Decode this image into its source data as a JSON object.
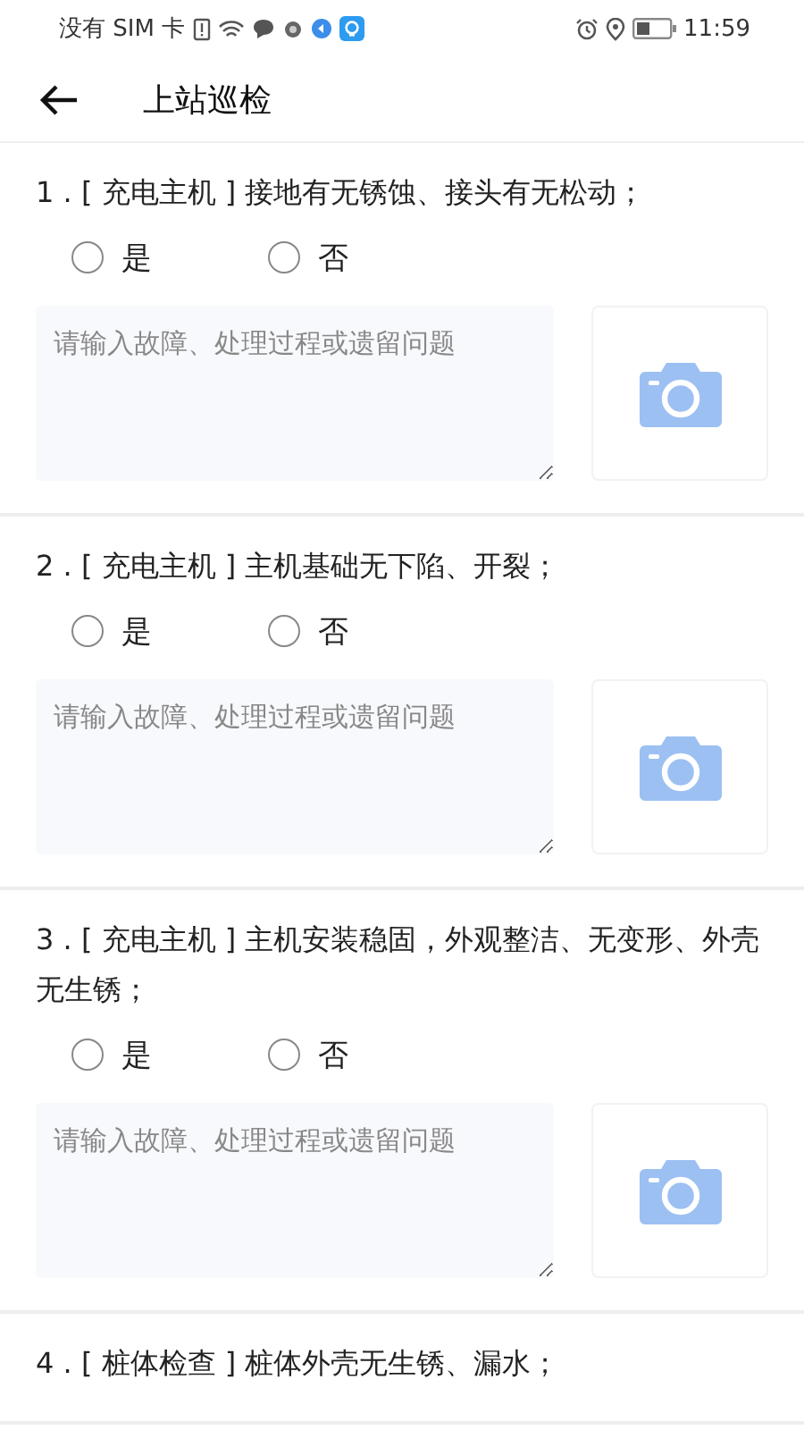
{
  "status_bar": {
    "carrier": "没有 SIM 卡",
    "time": "11:59"
  },
  "header": {
    "title": "上站巡检"
  },
  "items": [
    {
      "question": "1 . [ 充电主机 ] 接地有无锈蚀、接头有无松动；",
      "options": [
        {
          "label": "是",
          "selected": false
        },
        {
          "label": "否",
          "selected": false
        }
      ],
      "note": {
        "placeholder": "请输入故障、处理过程或遗留问题"
      }
    },
    {
      "question": "2 . [ 充电主机 ] 主机基础无下陷、开裂；",
      "options": [
        {
          "label": "是",
          "selected": false
        },
        {
          "label": "否",
          "selected": false
        }
      ],
      "note": {
        "placeholder": "请输入故障、处理过程或遗留问题"
      }
    },
    {
      "question": "3 . [ 充电主机 ] 主机安装稳固，外观整洁、无变形、外壳无生锈；",
      "options": [
        {
          "label": "是",
          "selected": false
        },
        {
          "label": "否",
          "selected": false
        }
      ],
      "note": {
        "placeholder": "请输入故障、处理过程或遗留问题"
      }
    },
    {
      "question": "4 . [ 桩体检查 ] 桩体外壳无生锈、漏水；"
    }
  ]
}
